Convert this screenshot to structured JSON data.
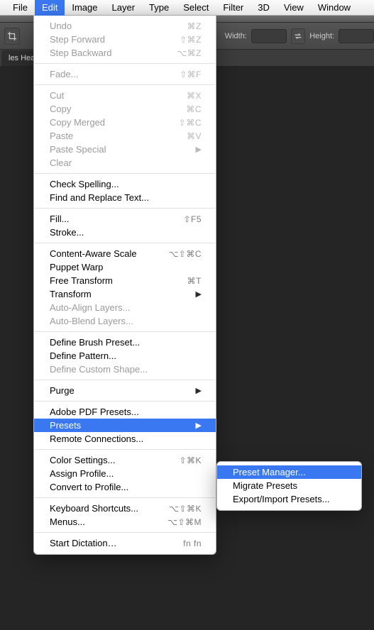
{
  "menubar": {
    "items": [
      {
        "label": "File"
      },
      {
        "label": "Edit"
      },
      {
        "label": "Image"
      },
      {
        "label": "Layer"
      },
      {
        "label": "Type"
      },
      {
        "label": "Select"
      },
      {
        "label": "Filter"
      },
      {
        "label": "3D"
      },
      {
        "label": "View"
      },
      {
        "label": "Window"
      }
    ],
    "active_index": 1
  },
  "options_bar": {
    "width_label": "Width:",
    "height_label": "Height:"
  },
  "doc_tab": {
    "label": "les Heade"
  },
  "edit_menu": {
    "groups": [
      [
        {
          "label": "Undo",
          "shortcut": "⌘Z",
          "disabled": true
        },
        {
          "label": "Step Forward",
          "shortcut": "⇧⌘Z",
          "disabled": true
        },
        {
          "label": "Step Backward",
          "shortcut": "⌥⌘Z",
          "disabled": true
        }
      ],
      [
        {
          "label": "Fade...",
          "shortcut": "⇧⌘F",
          "disabled": true
        }
      ],
      [
        {
          "label": "Cut",
          "shortcut": "⌘X",
          "disabled": true
        },
        {
          "label": "Copy",
          "shortcut": "⌘C",
          "disabled": true
        },
        {
          "label": "Copy Merged",
          "shortcut": "⇧⌘C",
          "disabled": true
        },
        {
          "label": "Paste",
          "shortcut": "⌘V",
          "disabled": true
        },
        {
          "label": "Paste Special",
          "submenu": true,
          "disabled": true
        },
        {
          "label": "Clear",
          "disabled": true
        }
      ],
      [
        {
          "label": "Check Spelling..."
        },
        {
          "label": "Find and Replace Text..."
        }
      ],
      [
        {
          "label": "Fill...",
          "shortcut": "⇧F5"
        },
        {
          "label": "Stroke..."
        }
      ],
      [
        {
          "label": "Content-Aware Scale",
          "shortcut": "⌥⇧⌘C"
        },
        {
          "label": "Puppet Warp"
        },
        {
          "label": "Free Transform",
          "shortcut": "⌘T"
        },
        {
          "label": "Transform",
          "submenu": true
        },
        {
          "label": "Auto-Align Layers...",
          "disabled": true
        },
        {
          "label": "Auto-Blend Layers...",
          "disabled": true
        }
      ],
      [
        {
          "label": "Define Brush Preset..."
        },
        {
          "label": "Define Pattern..."
        },
        {
          "label": "Define Custom Shape...",
          "disabled": true
        }
      ],
      [
        {
          "label": "Purge",
          "submenu": true
        }
      ],
      [
        {
          "label": "Adobe PDF Presets..."
        },
        {
          "label": "Presets",
          "submenu": true,
          "highlight": true
        },
        {
          "label": "Remote Connections..."
        }
      ],
      [
        {
          "label": "Color Settings...",
          "shortcut": "⇧⌘K"
        },
        {
          "label": "Assign Profile..."
        },
        {
          "label": "Convert to Profile..."
        }
      ],
      [
        {
          "label": "Keyboard Shortcuts...",
          "shortcut": "⌥⇧⌘K"
        },
        {
          "label": "Menus...",
          "shortcut": "⌥⇧⌘M"
        }
      ],
      [
        {
          "label": "Start Dictation…",
          "shortcut": "fn fn"
        }
      ]
    ]
  },
  "presets_submenu": {
    "items": [
      {
        "label": "Preset Manager...",
        "highlight": true
      },
      {
        "label": "Migrate Presets"
      },
      {
        "label": "Export/Import Presets..."
      }
    ]
  }
}
